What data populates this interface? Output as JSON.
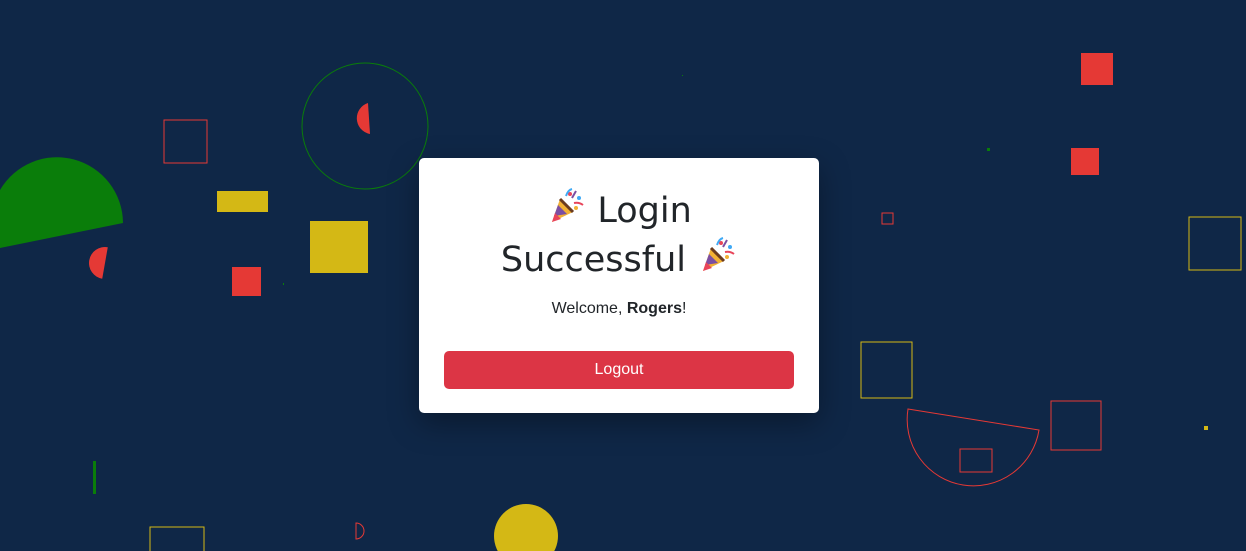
{
  "card": {
    "title_line1": "Login",
    "title_line2": "Successful",
    "welcome_prefix": "Welcome, ",
    "username": "Rogers",
    "welcome_suffix": "!",
    "logout_label": "Logout"
  },
  "colors": {
    "background": "#0f2747",
    "card": "#ffffff",
    "logout_button": "#dc3545",
    "shape_red": "#e53935",
    "shape_yellow": "#d4b815",
    "shape_green": "#0a7d0a"
  },
  "icons": {
    "party": "party-popper-icon"
  }
}
